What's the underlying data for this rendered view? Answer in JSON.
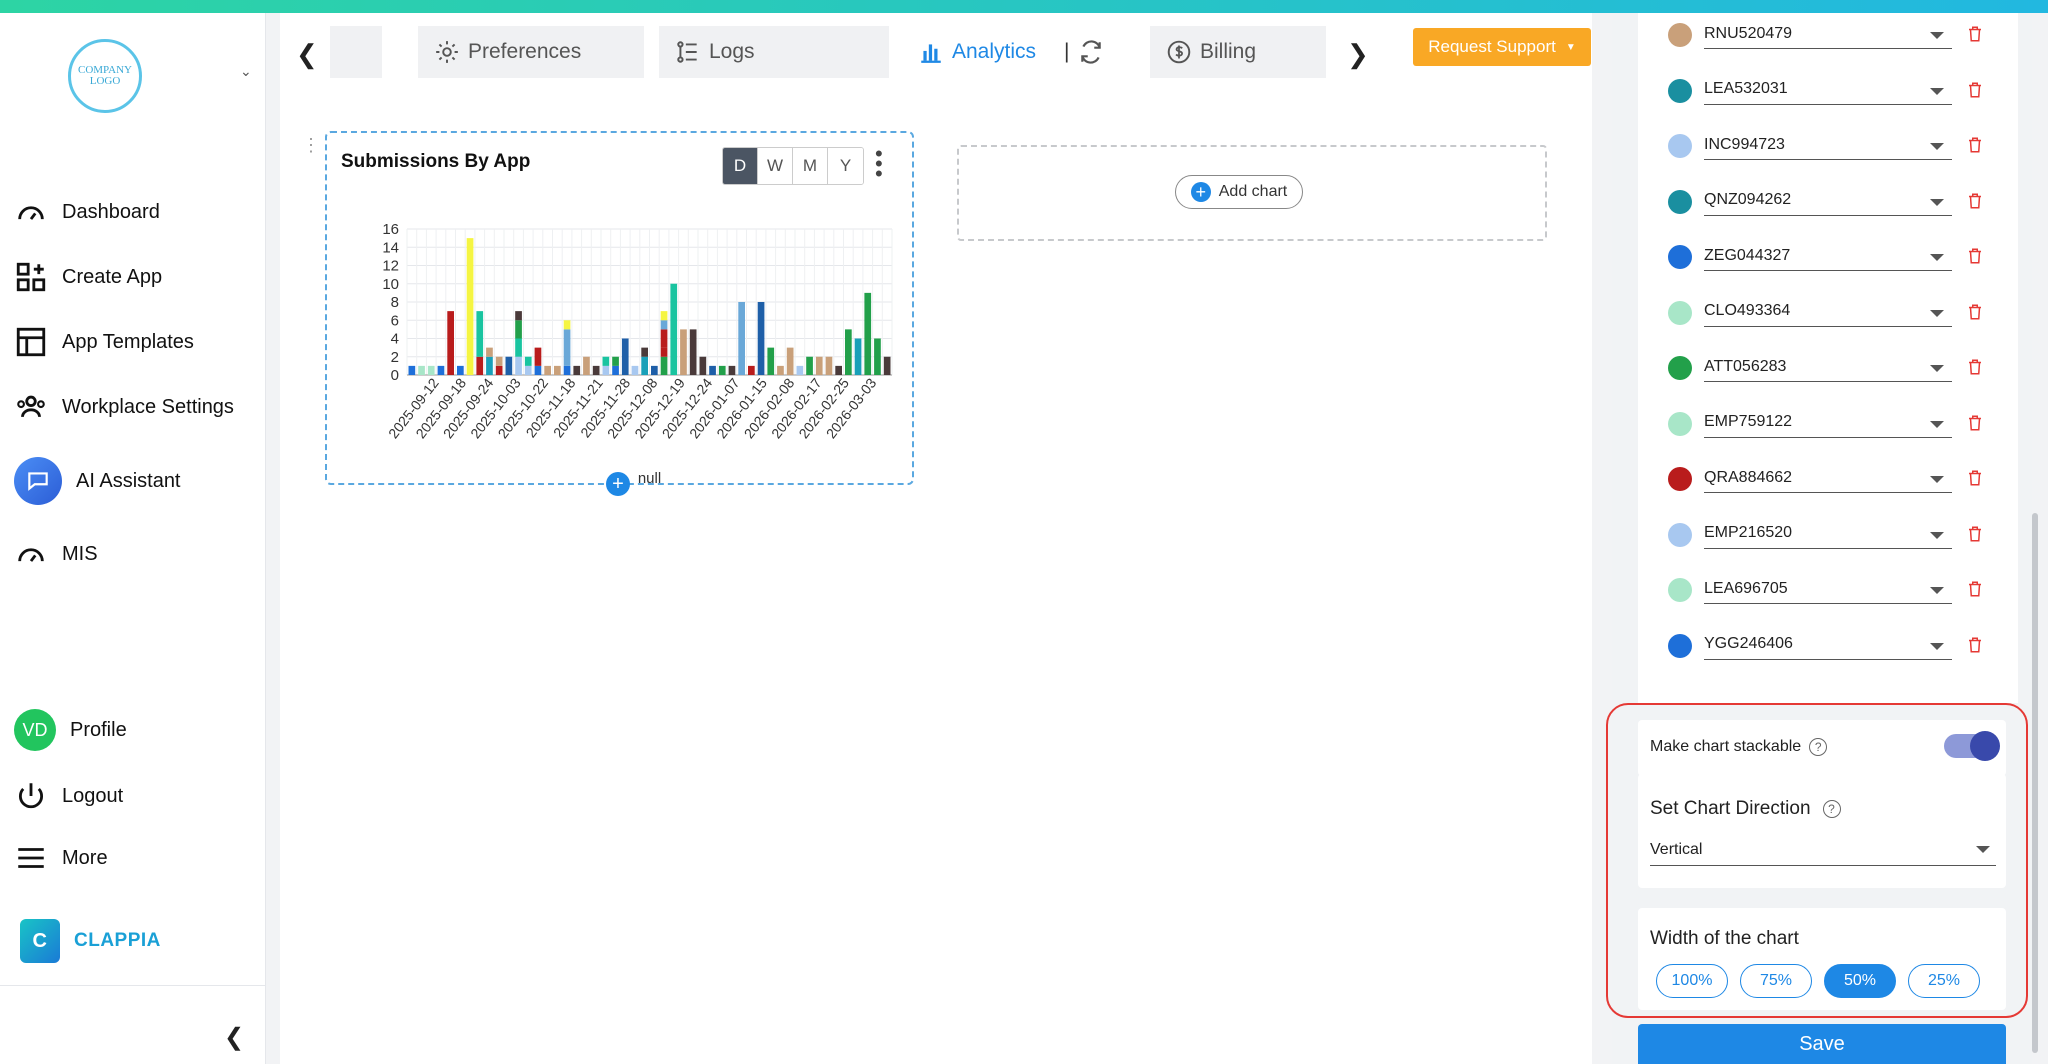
{
  "logo_text": "COMPANY LOGO",
  "nav": {
    "dashboard": "Dashboard",
    "create_app": "Create App",
    "app_templates": "App Templates",
    "workplace_settings": "Workplace Settings",
    "ai_assistant": "AI Assistant",
    "mis": "MIS",
    "profile": "Profile",
    "profile_initials": "VD",
    "logout": "Logout",
    "more": "More"
  },
  "brand": {
    "name": "CLAPPIA",
    "icon_letter": "C"
  },
  "tabs": {
    "preferences": "Preferences",
    "logs": "Logs",
    "analytics": "Analytics",
    "billing": "Billing",
    "separator": "|"
  },
  "request_support": "Request Support",
  "add_chart": "Add chart",
  "periods": [
    "D",
    "W",
    "M",
    "Y"
  ],
  "selected_period": "D",
  "chart_data": {
    "type": "bar",
    "title": "Submissions By App",
    "xlabel": "null",
    "ylabel": "",
    "ylim": [
      0,
      16
    ],
    "yticks": [
      0,
      2,
      4,
      6,
      8,
      10,
      12,
      14,
      16
    ],
    "stacked": true,
    "tick_labels": [
      "2025-09-12",
      "2025-09-18",
      "2025-09-24",
      "2025-10-03",
      "2025-10-22",
      "2025-11-18",
      "2025-11-21",
      "2025-11-28",
      "2025-12-08",
      "2025-12-19",
      "2025-12-24",
      "2026-01-07",
      "2026-01-15",
      "2026-02-08",
      "2026-02-17",
      "2026-02-25",
      "2026-03-03"
    ],
    "bars": [
      [
        [
          1,
          "#1e6fd9"
        ]
      ],
      [
        [
          1,
          "#a8e6c8"
        ]
      ],
      [
        [
          1,
          "#a8e6c8"
        ]
      ],
      [
        [
          1,
          "#1e6fd9"
        ]
      ],
      [
        [
          7,
          "#b91c1c"
        ]
      ],
      [
        [
          1,
          "#1e6fd9"
        ]
      ],
      [
        [
          15,
          "#f5f542"
        ]
      ],
      [
        [
          2,
          "#b91c1c"
        ],
        [
          5,
          "#19c4a0"
        ]
      ],
      [
        [
          2,
          "#19a0b8"
        ],
        [
          1,
          "#c9a07a"
        ]
      ],
      [
        [
          1,
          "#b91c1c"
        ],
        [
          1,
          "#c9a07a"
        ]
      ],
      [
        [
          2,
          "#1e5fa8"
        ]
      ],
      [
        [
          2,
          "#a8c8f0"
        ],
        [
          2,
          "#19c4a0"
        ],
        [
          2,
          "#22a04a"
        ],
        [
          1,
          "#4a3a3a"
        ]
      ],
      [
        [
          1,
          "#a8c8f0"
        ],
        [
          1,
          "#19c4a0"
        ]
      ],
      [
        [
          1,
          "#1e6fd9"
        ],
        [
          2,
          "#b91c1c"
        ]
      ],
      [
        [
          1,
          "#c9a07a"
        ]
      ],
      [
        [
          1,
          "#c9a07a"
        ]
      ],
      [
        [
          1,
          "#1e6fd9"
        ],
        [
          4,
          "#6aa8d8"
        ],
        [
          1,
          "#f5f542"
        ]
      ],
      [
        [
          1,
          "#4a3a3a"
        ]
      ],
      [
        [
          2,
          "#c9a07a"
        ]
      ],
      [
        [
          1,
          "#4a3a3a"
        ]
      ],
      [
        [
          1,
          "#a8c8f0"
        ],
        [
          1,
          "#19c4a0"
        ]
      ],
      [
        [
          1,
          "#1e6fd9"
        ],
        [
          1,
          "#22a04a"
        ]
      ],
      [
        [
          4,
          "#1e5fa8"
        ]
      ],
      [
        [
          1,
          "#a8c8f0"
        ]
      ],
      [
        [
          2,
          "#19a0b8"
        ],
        [
          1,
          "#4a3a3a"
        ]
      ],
      [
        [
          1,
          "#1e5fa8"
        ]
      ],
      [
        [
          2,
          "#22a04a"
        ],
        [
          1,
          "#b91c1c"
        ],
        [
          2,
          "#b91c1c"
        ],
        [
          1,
          "#6aa8d8"
        ],
        [
          1,
          "#f5f542"
        ]
      ],
      [
        [
          10,
          "#19c4a0"
        ]
      ],
      [
        [
          5,
          "#c9a07a"
        ]
      ],
      [
        [
          5,
          "#4a3a3a"
        ]
      ],
      [
        [
          2,
          "#4a3a3a"
        ]
      ],
      [
        [
          1,
          "#1e5fa8"
        ]
      ],
      [
        [
          1,
          "#22a04a"
        ]
      ],
      [
        [
          1,
          "#4a3a3a"
        ]
      ],
      [
        [
          8,
          "#6aa8d8"
        ]
      ],
      [
        [
          1,
          "#b91c1c"
        ]
      ],
      [
        [
          8,
          "#1e5fa8"
        ]
      ],
      [
        [
          3,
          "#22a04a"
        ]
      ],
      [
        [
          1,
          "#c9a07a"
        ]
      ],
      [
        [
          3,
          "#c9a07a"
        ]
      ],
      [
        [
          1,
          "#a8c8f0"
        ]
      ],
      [
        [
          2,
          "#22a04a"
        ]
      ],
      [
        [
          2,
          "#c9a07a"
        ]
      ],
      [
        [
          2,
          "#c9a07a"
        ]
      ],
      [
        [
          1,
          "#4a3a3a"
        ]
      ],
      [
        [
          5,
          "#22a04a"
        ]
      ],
      [
        [
          4,
          "#19a0b8"
        ]
      ],
      [
        [
          9,
          "#22a04a"
        ]
      ],
      [
        [
          4,
          "#22a04a"
        ]
      ],
      [
        [
          2,
          "#4a3a3a"
        ]
      ]
    ]
  },
  "series": [
    {
      "name": "RNU520479",
      "color": "#c9a07a"
    },
    {
      "name": "LEA532031",
      "color": "#1a8fa0"
    },
    {
      "name": "INC994723",
      "color": "#a8c8f0"
    },
    {
      "name": "QNZ094262",
      "color": "#1a8fa0"
    },
    {
      "name": "ZEG044327",
      "color": "#1e6fd9"
    },
    {
      "name": "CLO493364",
      "color": "#a8e6c8"
    },
    {
      "name": "ATT056283",
      "color": "#22a04a"
    },
    {
      "name": "EMP759122",
      "color": "#a8e6c8"
    },
    {
      "name": "QRA884662",
      "color": "#b91c1c"
    },
    {
      "name": "EMP216520",
      "color": "#a8c8f0"
    },
    {
      "name": "LEA696705",
      "color": "#a8e6c8"
    },
    {
      "name": "YGG246406",
      "color": "#1e6fd9"
    }
  ],
  "options": {
    "stackable_label": "Make chart stackable",
    "stackable_on": true,
    "direction_label": "Set Chart Direction",
    "direction_value": "Vertical",
    "width_label": "Width of the chart",
    "width_options": [
      "100%",
      "75%",
      "50%",
      "25%"
    ],
    "width_selected": "50%",
    "help": "?"
  },
  "save": "Save"
}
